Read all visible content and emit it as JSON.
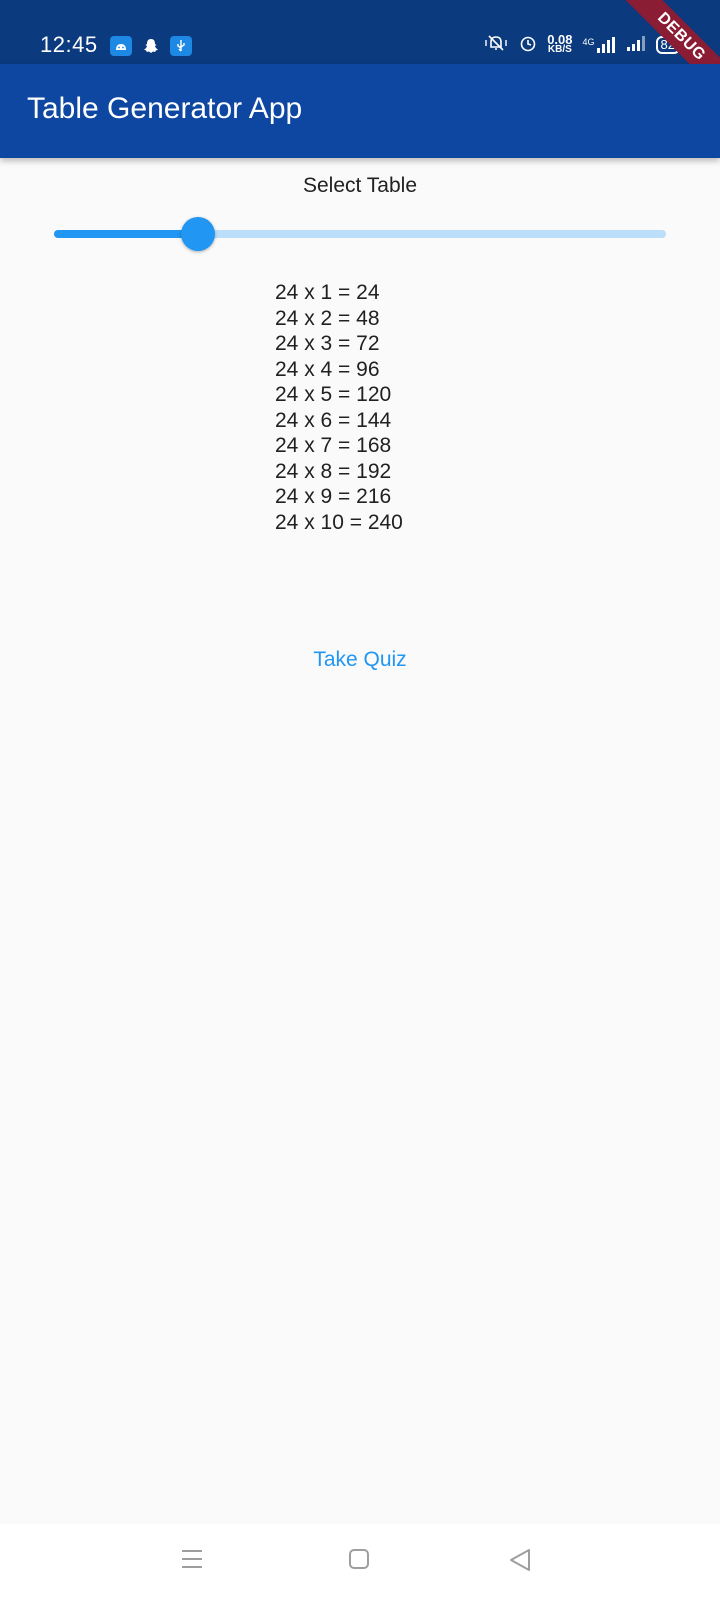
{
  "status_bar": {
    "time": "12:45",
    "net_speed_value": "0.08",
    "net_speed_unit": "KB/S",
    "network_type": "4G",
    "battery": "82",
    "icons": [
      "android-icon",
      "snapchat-icon",
      "usb-icon",
      "vibrate-mute-icon",
      "alarm-icon",
      "signal-icon",
      "battery-icon"
    ]
  },
  "debug_banner": "DEBUG",
  "app_bar": {
    "title": "Table Generator App"
  },
  "main": {
    "select_label": "Select Table",
    "slider": {
      "value": 24,
      "fraction": 0.235
    },
    "table_lines": [
      "24 x 1 = 24",
      "24 x 2 = 48",
      "24 x 3 = 72",
      "24 x 4 = 96",
      "24 x 5 = 120",
      "24 x 6 = 144",
      "24 x 7 = 168",
      "24 x 8 = 192",
      "24 x 9 = 216",
      "24 x 10 = 240"
    ],
    "quiz_button": "Take Quiz"
  },
  "colors": {
    "status_bar": "#0b3a7e",
    "app_bar": "#0d47a1",
    "accent": "#2196f3",
    "slider_inactive": "#bbdefb",
    "debug_banner": "#8a1c34"
  }
}
